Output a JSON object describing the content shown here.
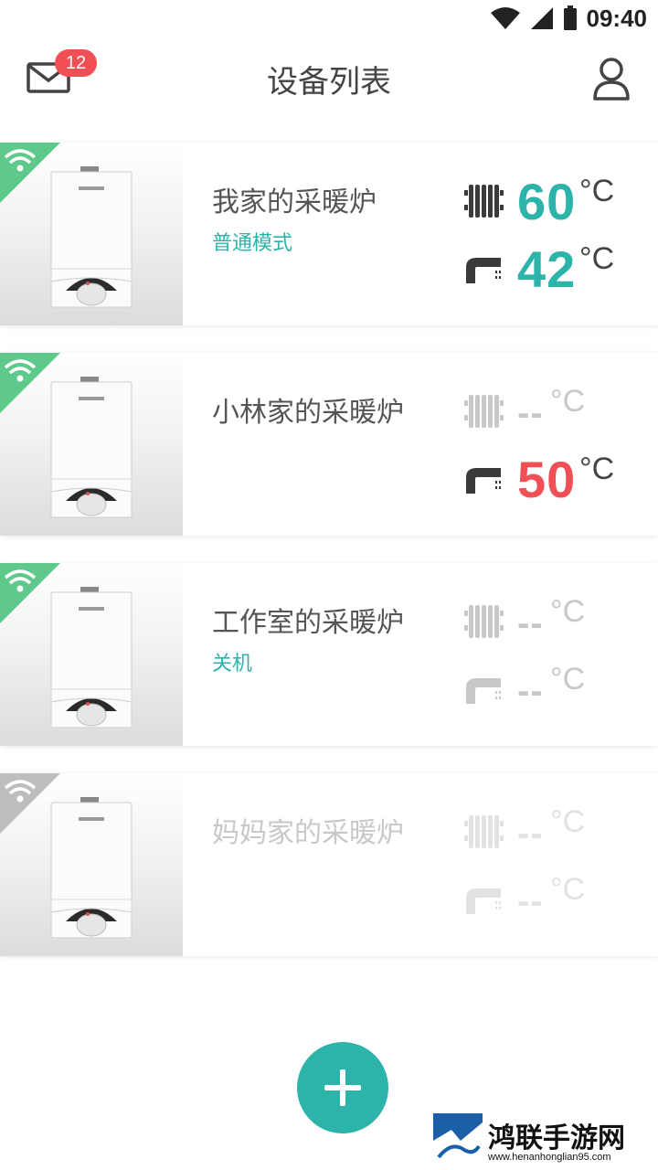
{
  "status_bar": {
    "time": "09:40"
  },
  "header": {
    "title": "设备列表",
    "unread_count": "12"
  },
  "devices": [
    {
      "name": "我家的采暖炉",
      "mode": "普通模式",
      "online": true,
      "heating_temp": "60",
      "water_temp": "42",
      "unit": "°C",
      "heating_color": "#2db4aa",
      "water_color": "#2db4aa"
    },
    {
      "name": "小林家的采暖炉",
      "mode": "",
      "online": true,
      "heating_temp": "--",
      "water_temp": "50",
      "unit": "°C",
      "heating_color": "#c8c8c8",
      "water_color": "#ef4f55"
    },
    {
      "name": "工作室的采暖炉",
      "mode": "关机",
      "online": true,
      "heating_temp": "--",
      "water_temp": "--",
      "unit": "°C",
      "heating_color": "#c8c8c8",
      "water_color": "#c8c8c8"
    },
    {
      "name": "妈妈家的采暖炉",
      "mode": "",
      "online": false,
      "heating_temp": "--",
      "water_temp": "--",
      "unit": "°C",
      "heating_color": "#e2e2e2",
      "water_color": "#e2e2e2"
    }
  ],
  "icons": {
    "mail": "mail-icon",
    "user": "user-icon",
    "add": "plus-icon",
    "wifi": "wifi-icon",
    "radiator": "radiator-icon",
    "faucet": "faucet-icon"
  },
  "colors": {
    "accent": "#2db4aa",
    "alert": "#ef4f55",
    "online": "#5ec98a",
    "offline": "#bdbdbd"
  },
  "watermark": {
    "name": "鸿联手游网",
    "url": "www.henanhonglian95.com"
  }
}
